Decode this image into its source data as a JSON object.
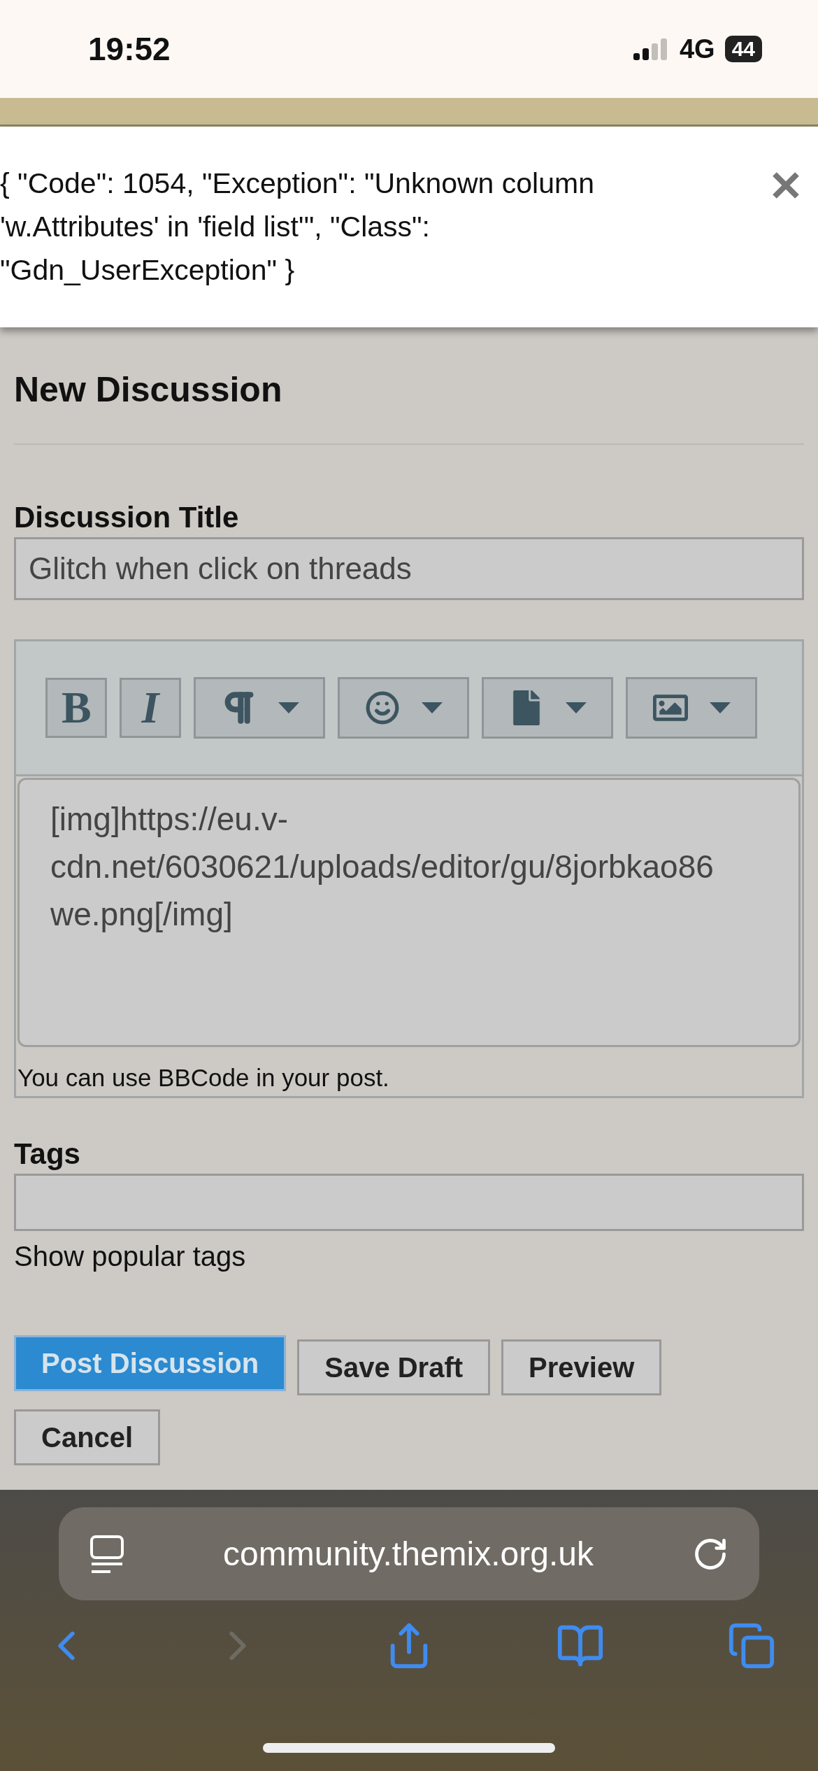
{
  "status_bar": {
    "time": "19:52",
    "network": "4G",
    "battery": "44"
  },
  "error_banner": {
    "message": "{ \"Code\": 1054, \"Exception\": \"Unknown column 'w.Attributes' in 'field list'\", \"Class\": \"Gdn_UserException\" }"
  },
  "page_title": "New Discussion",
  "title_field": {
    "label": "Discussion Title",
    "value": "Glitch when click on threads"
  },
  "editor": {
    "toolbar": [
      {
        "kind": "bold",
        "label": "B"
      },
      {
        "kind": "italic",
        "label": "I"
      },
      {
        "kind": "paragraph"
      },
      {
        "kind": "emoji"
      },
      {
        "kind": "file"
      },
      {
        "kind": "image"
      }
    ],
    "body": "[img]https://eu.v-cdn.net/6030621/uploads/editor/gu/8jorbkao86we.png[/img]",
    "hint": "You can use BBCode in your post."
  },
  "tags_field": {
    "label": "Tags",
    "link": "Show popular tags"
  },
  "buttons": [
    {
      "label": "Post Discussion",
      "kind": "primary"
    },
    {
      "label": "Save Draft",
      "kind": "secondary"
    },
    {
      "label": "Preview",
      "kind": "secondary"
    },
    {
      "label": "Cancel",
      "kind": "secondary"
    }
  ],
  "browser": {
    "url": "community.themix.org.uk",
    "nav": [
      {
        "kind": "back",
        "disabled": false
      },
      {
        "kind": "forward",
        "disabled": true
      },
      {
        "kind": "share",
        "disabled": false
      },
      {
        "kind": "bookmarks",
        "disabled": false
      },
      {
        "kind": "tabs",
        "disabled": false
      }
    ]
  }
}
